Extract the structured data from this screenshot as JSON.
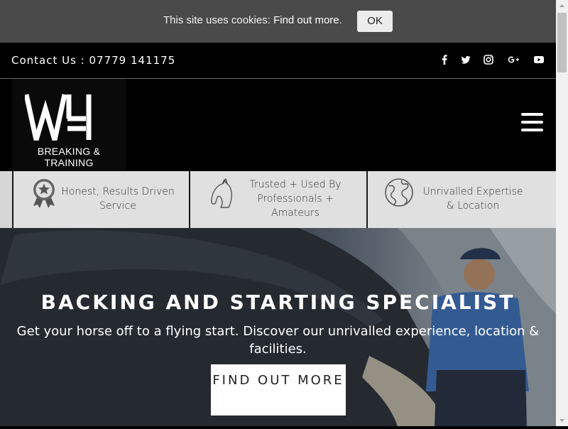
{
  "cookie_bar": {
    "text": "This site uses cookies:",
    "link": "Find out more.",
    "ok_label": "OK"
  },
  "contact_bar": {
    "text": "Contact Us : 07779 141175",
    "social_icons": [
      "facebook-icon",
      "twitter-icon",
      "instagram-icon",
      "google-plus-icon",
      "youtube-icon"
    ]
  },
  "header": {
    "logo_sub": "BREAKING & TRAINING",
    "menu_icon": "hamburger-menu-icon"
  },
  "features": [
    {
      "icon": "award-ribbon-icon",
      "text": "Honest, Results Driven Service"
    },
    {
      "icon": "horse-head-icon",
      "text": "Trusted + Used By Professionals + Amateurs"
    },
    {
      "icon": "globe-icon",
      "text": "Unrivalled Expertise & Location"
    }
  ],
  "hero": {
    "title": "BACKING AND STARTING SPECIALIST",
    "subtitle": "Get your horse off to a flying start. Discover our unrivalled experience, location & facilities.",
    "button_label": "FIND OUT MORE"
  },
  "colors": {
    "cookie_bg": "#4a4a4a",
    "header_bg": "#000000",
    "feature_bg": "#e0e0e0",
    "button_bg": "#ffffff"
  }
}
